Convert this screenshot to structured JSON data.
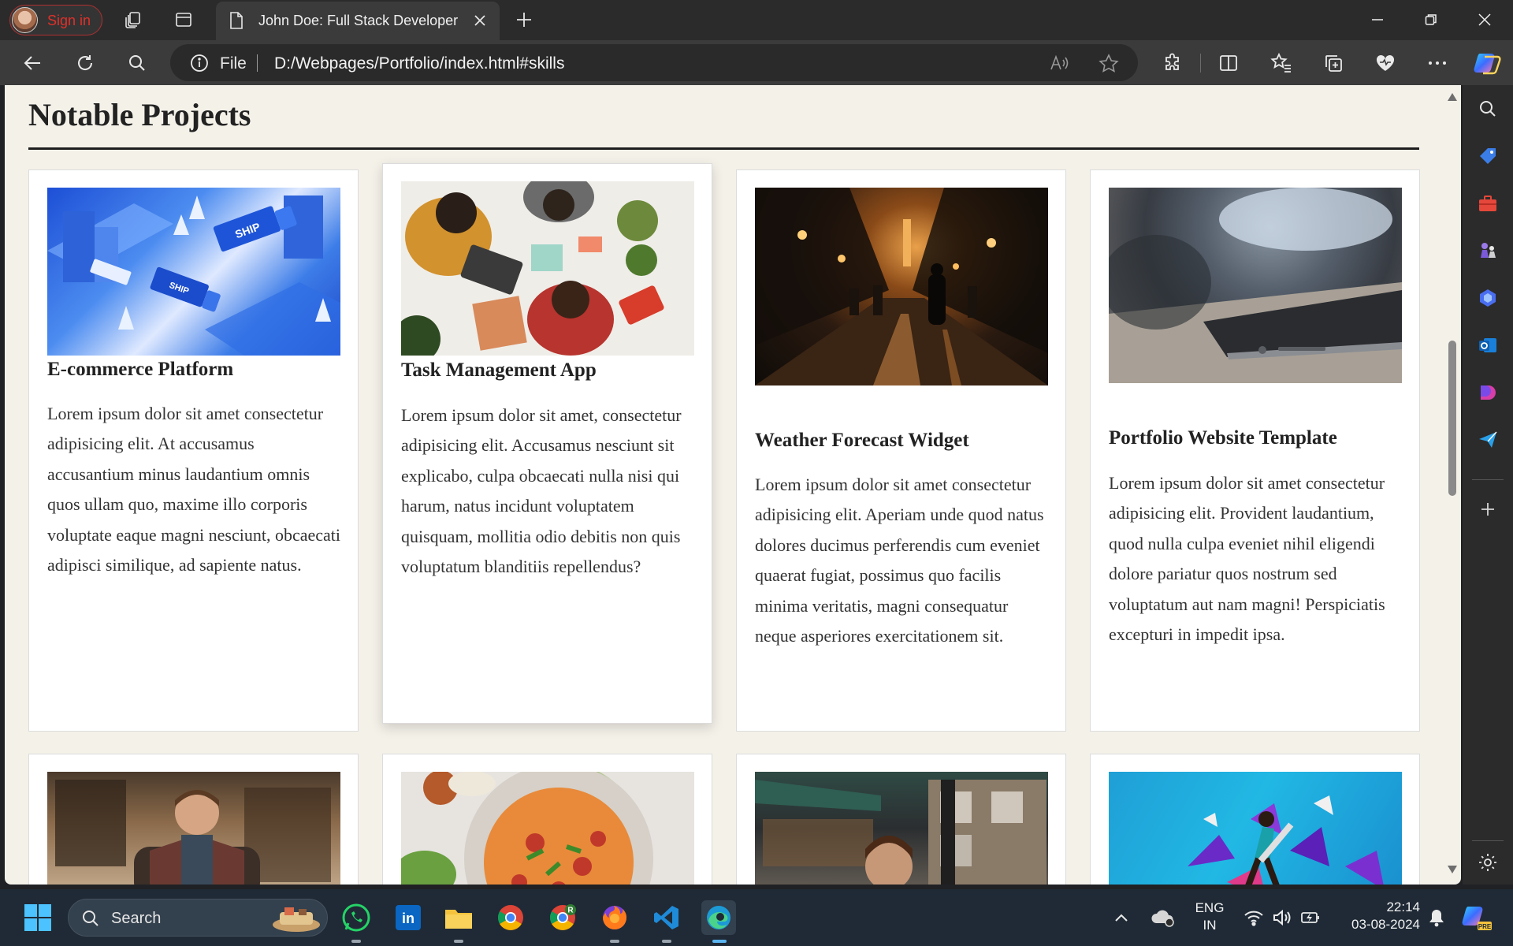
{
  "browser": {
    "signin_label": "Sign in",
    "tab_title": "John Doe: Full Stack Developer",
    "address_scheme": "File",
    "address_url": "D:/Webpages/Portfolio/index.html#skills",
    "accent_color": "#e0302a"
  },
  "page": {
    "section_title": "Notable Projects",
    "background_color": "#f4f1e9",
    "projects": [
      {
        "title": "E-commerce Platform",
        "description": "Lorem ipsum dolor sit amet consectetur adipisicing elit. At accusamus accusantium minus laudantium omnis quos ullam quo, maxime illo corporis voluptate eaque magni nesciunt, obcaecati adipisci similique, ad sapiente natus.",
        "image": "isometric-shipping-city-image"
      },
      {
        "title": "Task Management App",
        "description": "Lorem ipsum dolor sit amet, consectetur adipisicing elit. Accusamus nesciunt sit explicabo, culpa obcaecati nulla nisi qui harum, natus incidunt voluptatem quisquam, mollitia odio debitis non quis voluptatum blanditiis repellendus?",
        "image": "team-working-at-desk-image"
      },
      {
        "title": "Weather Forecast Widget",
        "description": "Lorem ipsum dolor sit amet consectetur adipisicing elit. Aperiam unde quod natus dolores ducimus perferendis cum eveniet quaerat fugiat, possimus quo facilis minima veritatis, magni consequatur neque asperiores exercitationem sit.",
        "image": "rainy-night-street-image"
      },
      {
        "title": "Portfolio Website Template",
        "description": "Lorem ipsum dolor sit amet consectetur adipisicing elit. Provident laudantium, quod nulla culpa eveniet nihil eligendi dolore pariatur quos nostrum sed voluptatum aut nam magni! Perspiciatis excepturi in impedit ipsa.",
        "image": "smartphone-closeup-image"
      }
    ],
    "second_row_images": [
      "man-presenting-image",
      "pizza-plate-image",
      "cafe-street-image",
      "sports-splash-image"
    ]
  },
  "taskbar": {
    "search_label": "Search",
    "language_top": "ENG",
    "language_bottom": "IN",
    "time": "22:14",
    "date": "03-08-2024"
  }
}
